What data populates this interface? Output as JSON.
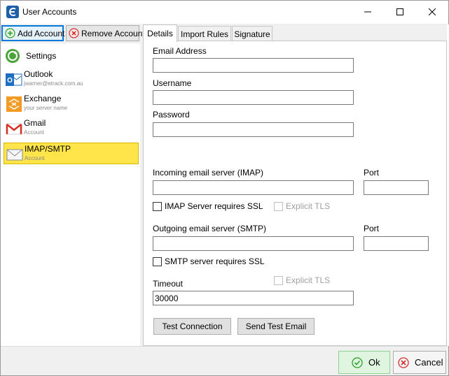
{
  "window": {
    "title": "User Accounts",
    "colors": {
      "accent": "#0078d7",
      "selected": "#ffe44a",
      "ok_green": "#2e9e2e",
      "cancel_red": "#d62e2e"
    }
  },
  "toolbar": {
    "add_label": "Add Account",
    "remove_label": "Remove Account"
  },
  "sidebar": {
    "settings_label": "Settings",
    "accounts": [
      {
        "name": "Outlook",
        "sub": "jwarner@etrack.com.au",
        "icon": "outlook-icon"
      },
      {
        "name": "Exchange",
        "sub": "your server name",
        "icon": "exchange-icon"
      },
      {
        "name": "Gmail",
        "sub": "Account",
        "icon": "gmail-icon"
      },
      {
        "name": "IMAP/SMTP",
        "sub": "Account",
        "icon": "envelope-icon",
        "selected": true
      }
    ]
  },
  "tabs": [
    "Details",
    "Import Rules",
    "Signature"
  ],
  "form": {
    "email_label": "Email Address",
    "email_value": "",
    "username_label": "Username",
    "username_value": "",
    "password_label": "Password",
    "password_value": "",
    "incoming_label": "Incoming email server (IMAP)",
    "incoming_value": "",
    "incoming_port_label": "Port",
    "incoming_port_value": "",
    "imap_ssl_label": "IMAP Server requires SSL",
    "imap_tls_label": "Explicit TLS",
    "outgoing_label": "Outgoing email server (SMTP)",
    "outgoing_value": "",
    "outgoing_port_label": "Port",
    "outgoing_port_value": "",
    "smtp_ssl_label": "SMTP server requires SSL",
    "smtp_tls_label": "Explicit TLS",
    "timeout_label": "Timeout",
    "timeout_value": "30000",
    "test_connection_label": "Test Connection",
    "send_test_label": "Send Test Email"
  },
  "footer": {
    "ok_label": "Ok",
    "cancel_label": "Cancel"
  }
}
